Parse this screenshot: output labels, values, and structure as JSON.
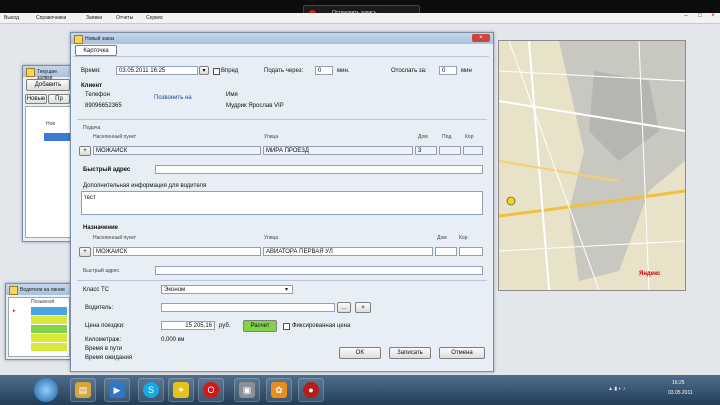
{
  "top_menu": [
    "Выход",
    "Справочники",
    "Заявки",
    "Отчеты",
    "Сервис"
  ],
  "recording": {
    "label": "Остановить запись"
  },
  "background_window": {
    "title": "Текущие заявки",
    "add_button": "Добавить",
    "tabs": [
      "Новые",
      "Пр"
    ],
    "row_text": "Нов"
  },
  "status_window": {
    "title": "Водители на линии",
    "header": "Позывной"
  },
  "dialog": {
    "title": "Новый заказ",
    "tab": "Карточка",
    "time_label": "Время:",
    "time_value": "03.05.2011 16:25",
    "forward_label": "Впред",
    "give_after_label": "Подать через:",
    "give_after_value": "0",
    "give_after_unit": "мин.",
    "report_label": "Отослать за:",
    "report_value": "0",
    "report_unit": "мин",
    "client_label": "Клиент",
    "phone_label": "Телефон",
    "phone_value": "89096652365",
    "call_button": "Позвонить на",
    "name_label": "Имя",
    "name_value": "Мудрик Ярослав VIP",
    "pickup_label": "Подача",
    "settlement_header": "Населенный пункт",
    "street_header": "Улица",
    "house_header": "Дом",
    "entrance_header": "Под.",
    "apt_header": "Кор",
    "pickup_settlement": "МОЖАЙСК",
    "pickup_street": "МИРА ПРОЕЗД",
    "pickup_house": "3",
    "quick_address_label": "Быстрый адрес",
    "info_label": "Дополнительная информация для водителя",
    "info_value": "тест",
    "destination_label": "Назначение",
    "destination_settlement": "МОЖАЙСК",
    "destination_street": "АВИАТОРА ПЕРВАЯ УЛ",
    "quick_address2_label": "Быстрый адрес",
    "class_label": "Класс ТС",
    "class_value": "Эконом",
    "driver_label": "Водитель:",
    "price_label": "Цена поездки:",
    "price_value": "15 205,16",
    "currency": "руб.",
    "recalc_button": "Расчет",
    "fixed_price_label": "Фиксированная цена",
    "distance_label": "Километраж:",
    "distance_value": "0,000 км",
    "travel_time_label": "Время в пути",
    "wait_time_label": "Время ожидания",
    "ok_button": "OK",
    "save_button": "Записать",
    "cancel_button": "Отмена"
  },
  "map": {
    "brand": "Яндекс"
  },
  "taskbar": {
    "clock_time": "16:25",
    "clock_date": "03.05.2011"
  },
  "colors": {
    "dialog_bg": "#e8eef6",
    "accent_green": "#7fd44a",
    "map_bg": "#e5dfc6",
    "taskbar": "#233d57"
  }
}
